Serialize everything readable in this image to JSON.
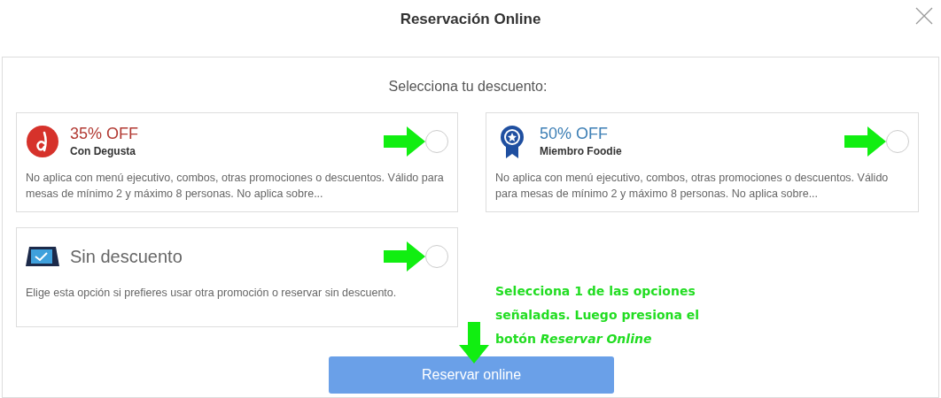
{
  "window": {
    "title": "Reservación Online"
  },
  "heading": "Selecciona tu descuento:",
  "options": [
    {
      "kind": "degusta",
      "title": "35% OFF",
      "subtitle": "Con Degusta",
      "description": "No aplica con menú ejecutivo, combos, otras promociones o descuentos. Válido para mesas de mínimo 2 y máximo 8 personas. No aplica sobre...",
      "color": "#b23a33",
      "selected": false
    },
    {
      "kind": "foodie",
      "title": "50% OFF",
      "subtitle": "Miembro Foodie",
      "description": "No aplica con menú ejecutivo, combos, otras promociones o descuentos. Válido para mesas de mínimo 2 y máximo 8 personas. No aplica sobre...",
      "color": "#3d7fb5",
      "selected": false
    },
    {
      "kind": "none",
      "title": "Sin descuento",
      "description": "Elige esta opción si prefieres usar otra promoción o reservar sin descuento.",
      "color": "#666666",
      "selected": false
    }
  ],
  "annotation": "Selecciona 1 de las opciones señaladas. Luego presiona el botón *Reservar Online*",
  "button": "Reservar online"
}
